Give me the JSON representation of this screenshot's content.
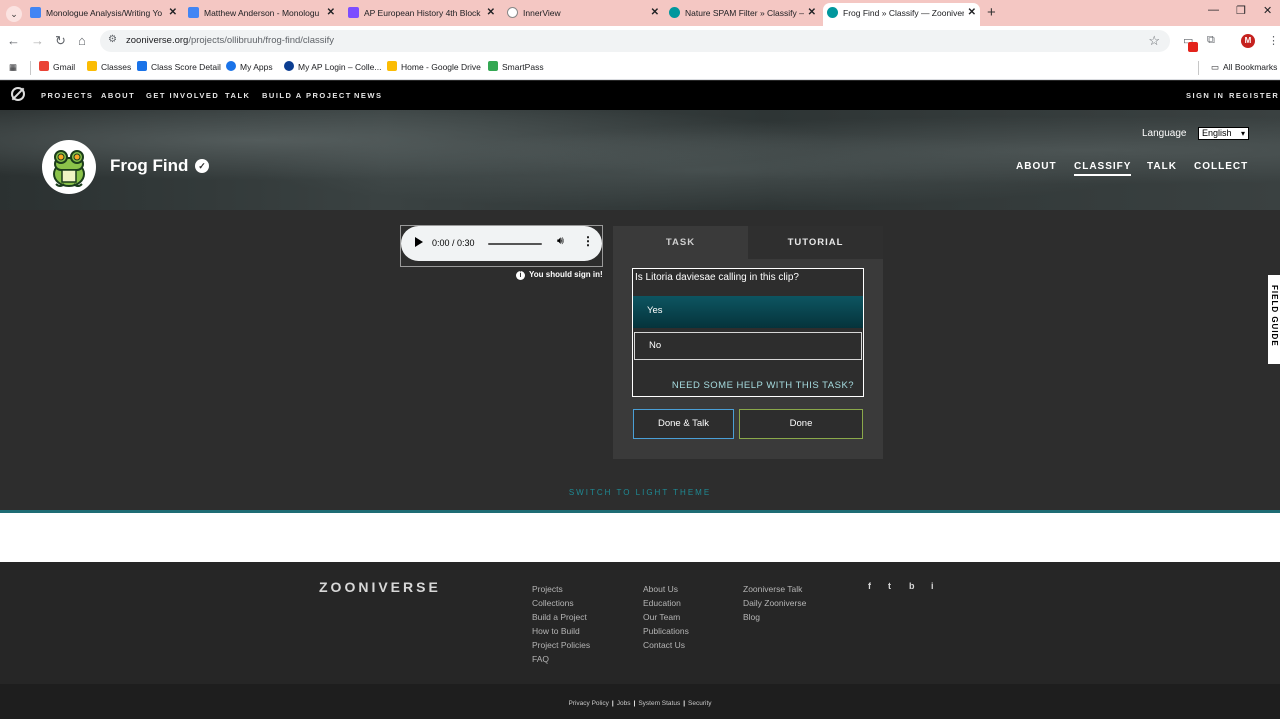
{
  "browser": {
    "tabs": [
      {
        "label": "Monologue Analysis/Writing Yo",
        "color": "#4285f4"
      },
      {
        "label": "Matthew Anderson - Monologu",
        "color": "#4285f4"
      },
      {
        "label": "AP European History 4th Block",
        "color": "#7c4dff"
      },
      {
        "label": "InnerView",
        "color": "#ffffff"
      },
      {
        "label": "Nature SPAM Filter » Classify —",
        "color": "#00979d"
      },
      {
        "label": "Frog Find » Classify — Zooniver",
        "color": "#00979d"
      }
    ],
    "url_domain": "zooniverse.org",
    "url_path": "/projects/ollibruuh/frog-find/classify",
    "avatar_letter": "M",
    "bookmarks": [
      {
        "label": "Gmail",
        "color": "#ea4335"
      },
      {
        "label": "Classes",
        "color": "#fbbc04"
      },
      {
        "label": "Class Score Detail",
        "color": "#1a73e8"
      },
      {
        "label": "My Apps",
        "color": "#1a73e8"
      },
      {
        "label": "My AP Login – Colle...",
        "color": "#0b3d91"
      },
      {
        "label": "Home - Google Drive",
        "color": "#fbbc04"
      },
      {
        "label": "SmartPass",
        "color": "#34a853"
      }
    ],
    "all_bookmarks": "All Bookmarks"
  },
  "zoo_nav": {
    "items": [
      "PROJECTS",
      "ABOUT",
      "GET INVOLVED",
      "TALK",
      "BUILD A PROJECT",
      "NEWS"
    ],
    "sign_in": "SIGN IN",
    "register": "REGISTER"
  },
  "project": {
    "title": "Frog Find",
    "language_label": "Language",
    "language_value": "English",
    "nav": [
      "ABOUT",
      "CLASSIFY",
      "TALK",
      "COLLECT"
    ]
  },
  "classify": {
    "audio_time": "0:00 / 0:30",
    "signin_note": "You should sign in!",
    "tabs": {
      "task": "TASK",
      "tutorial": "TUTORIAL"
    },
    "question": "Is Litoria daviesae calling in this clip?",
    "answers": {
      "yes": "Yes",
      "no": "No"
    },
    "help": "NEED SOME HELP WITH THIS TASK?",
    "done_talk": "Done & Talk",
    "done": "Done",
    "switch_theme": "SWITCH TO LIGHT THEME",
    "field_guide": "FIELD GUIDE"
  },
  "footer": {
    "brand": "ZOONIVERSE",
    "col1": [
      "Projects",
      "Collections",
      "Build a Project",
      "How to Build",
      "Project Policies",
      "FAQ"
    ],
    "col2": [
      "About Us",
      "Education",
      "Our Team",
      "Publications",
      "Contact Us"
    ],
    "col3": [
      "Zooniverse Talk",
      "Daily Zooniverse",
      "Blog"
    ],
    "social": [
      "f",
      "t",
      "b",
      "i"
    ],
    "legal": [
      "Privacy Policy",
      "Jobs",
      "System Status",
      "Security"
    ]
  },
  "colors": {
    "accent_teal": "#1e8a94",
    "yes_bg": "#0d5561",
    "done_talk_border": "#4a9fd6",
    "done_border": "#8aa84a"
  }
}
